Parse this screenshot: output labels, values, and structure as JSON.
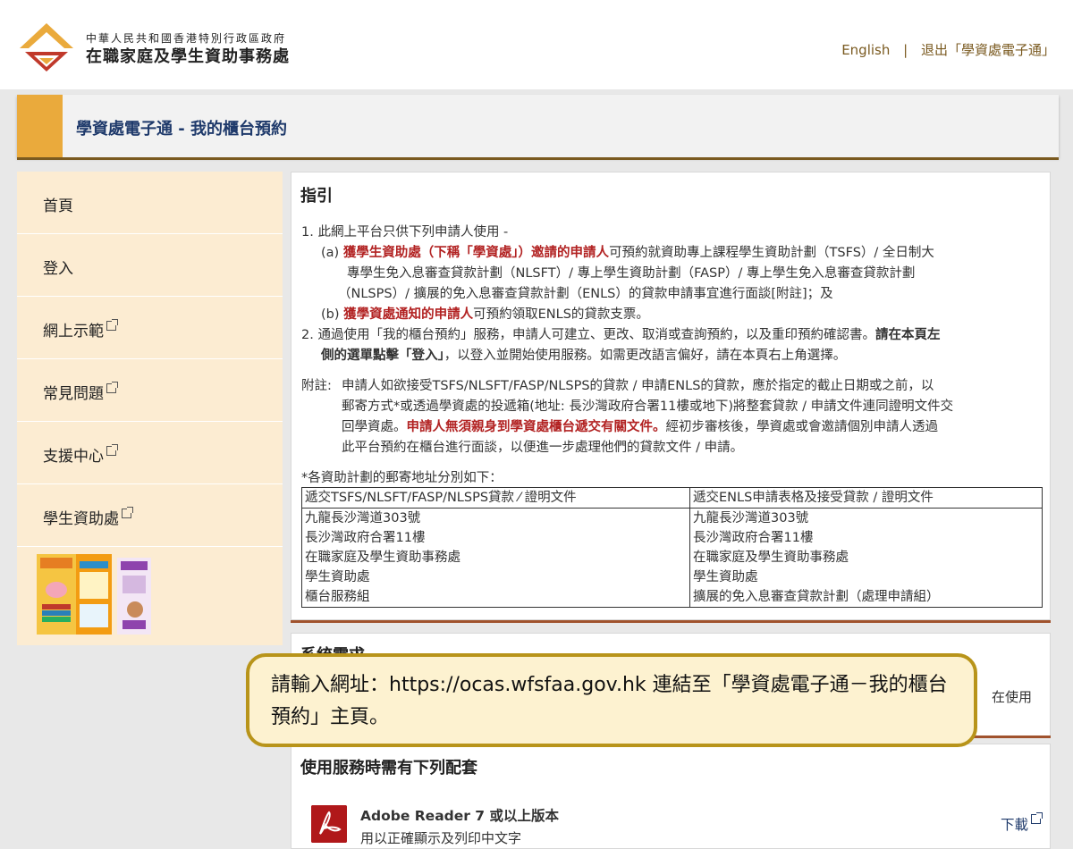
{
  "header": {
    "org_line1": "中華人民共和國香港特別行政區政府",
    "org_line2": "在職家庭及學生資助事務處",
    "lang_link": "English",
    "separator": "|",
    "logout_link": "退出「學資處電子通」"
  },
  "title": "學資處電子通 - 我的櫃台預約",
  "sidebar": {
    "items": [
      {
        "label": "首頁",
        "external": false
      },
      {
        "label": "登入",
        "external": false
      },
      {
        "label": "網上示範",
        "external": true
      },
      {
        "label": "常見問題",
        "external": true
      },
      {
        "label": "支援中心",
        "external": true
      },
      {
        "label": "學生資助處",
        "external": true
      }
    ]
  },
  "guide": {
    "heading": "指引",
    "p1": "1. 此網上平台只供下列申請人使用 -",
    "p1a_prefix": "(a) ",
    "p1a_red": "獲學生資助處（下稱「學資處」）邀請的申請人",
    "p1a_rest1": "可預約就資助專上課程學生資助計劃（TSFS）/ 全日制大",
    "p1a_rest2": "專學生免入息審查貸款計劃（NLSFT）/ 專上學生資助計劃（FASP）/ 專上學生免入息審查貸款計劃",
    "p1a_rest3": "（NLSPS）/ 擴展的免入息審查貸款計劃（ENLS）的貸款申請事宜進行面談[附註]；及",
    "p1b_prefix": "(b) ",
    "p1b_red": "獲學資處通知的申請人",
    "p1b_rest": "可預約領取ENLS的貸款支票。",
    "p2_line1a": "2. 通過使用「我的櫃台預約」服務，申請人可建立、更改、取消或查詢預約，以及重印預約確認書。",
    "p2_line1b": "請在本頁左",
    "p2_line2a": "側的選單點擊「登入」",
    "p2_line2b": "，以登入並開始使用服務。如需更改語言偏好，請在本頁右上角選擇。",
    "note_label": "附註:",
    "note_line1": "申請人如欲接受TSFS/NLSFT/FASP/NLSPS的貸款 / 申請ENLS的貸款，應於指定的截止日期或之前，以",
    "note_line2": "郵寄方式*或透過學資處的投遞箱(地址: 長沙灣政府合署11樓或地下)將整套貸款 / 申請文件連同證明文件交",
    "note_line3a": "回學資處。",
    "note_line3red": "申請人無須親身到學資處櫃台遞交有關文件。",
    "note_line3b": "經初步審核後，學資處或會邀請個別申請人透過",
    "note_line4": "此平台預約在櫃台進行面談，以便進一步處理他們的貸款文件 / 申請。",
    "addr_intro": "*各資助計劃的郵寄地址分別如下："
  },
  "address_table": {
    "headers": [
      "遞交TSFS/NLSFT/FASP/NLSPS貸款 ⁄ 證明文件",
      "遞交ENLS申請表格及接受貸款 / 證明文件"
    ],
    "col1": [
      "九龍長沙灣道303號",
      "長沙灣政府合署11樓",
      "在職家庭及學生資助事務處",
      "學生資助處",
      "櫃台服務組"
    ],
    "col2": [
      "九龍長沙灣道303號",
      "長沙灣政府合署11樓",
      "在職家庭及學生資助事務處",
      "學生資助處",
      "擴展的免入息審查貸款計劃（處理申請組）"
    ]
  },
  "system_panel": {
    "heading": "系統需求",
    "right_text": "在使用"
  },
  "package_panel": {
    "heading": "使用服務時需有下列配套",
    "product_name": "Adobe Reader 7 或以上版本",
    "product_desc": "用以正確顯示及列印中文字",
    "download": "下載"
  },
  "callout": {
    "text": "請輸入網址：https://ocas.wfsfaa.gov.hk 連結至「學資處電子通－我的櫃台預約」主頁。"
  },
  "colors": {
    "accent_orange": "#eaaa3c",
    "title_blue": "#1f3a6b",
    "red_text": "#b22222",
    "link_brown": "#7a5a20",
    "sidebar_bg": "#fcecd2",
    "callout_bg": "#fdf2d0",
    "callout_border": "#b8941a"
  }
}
